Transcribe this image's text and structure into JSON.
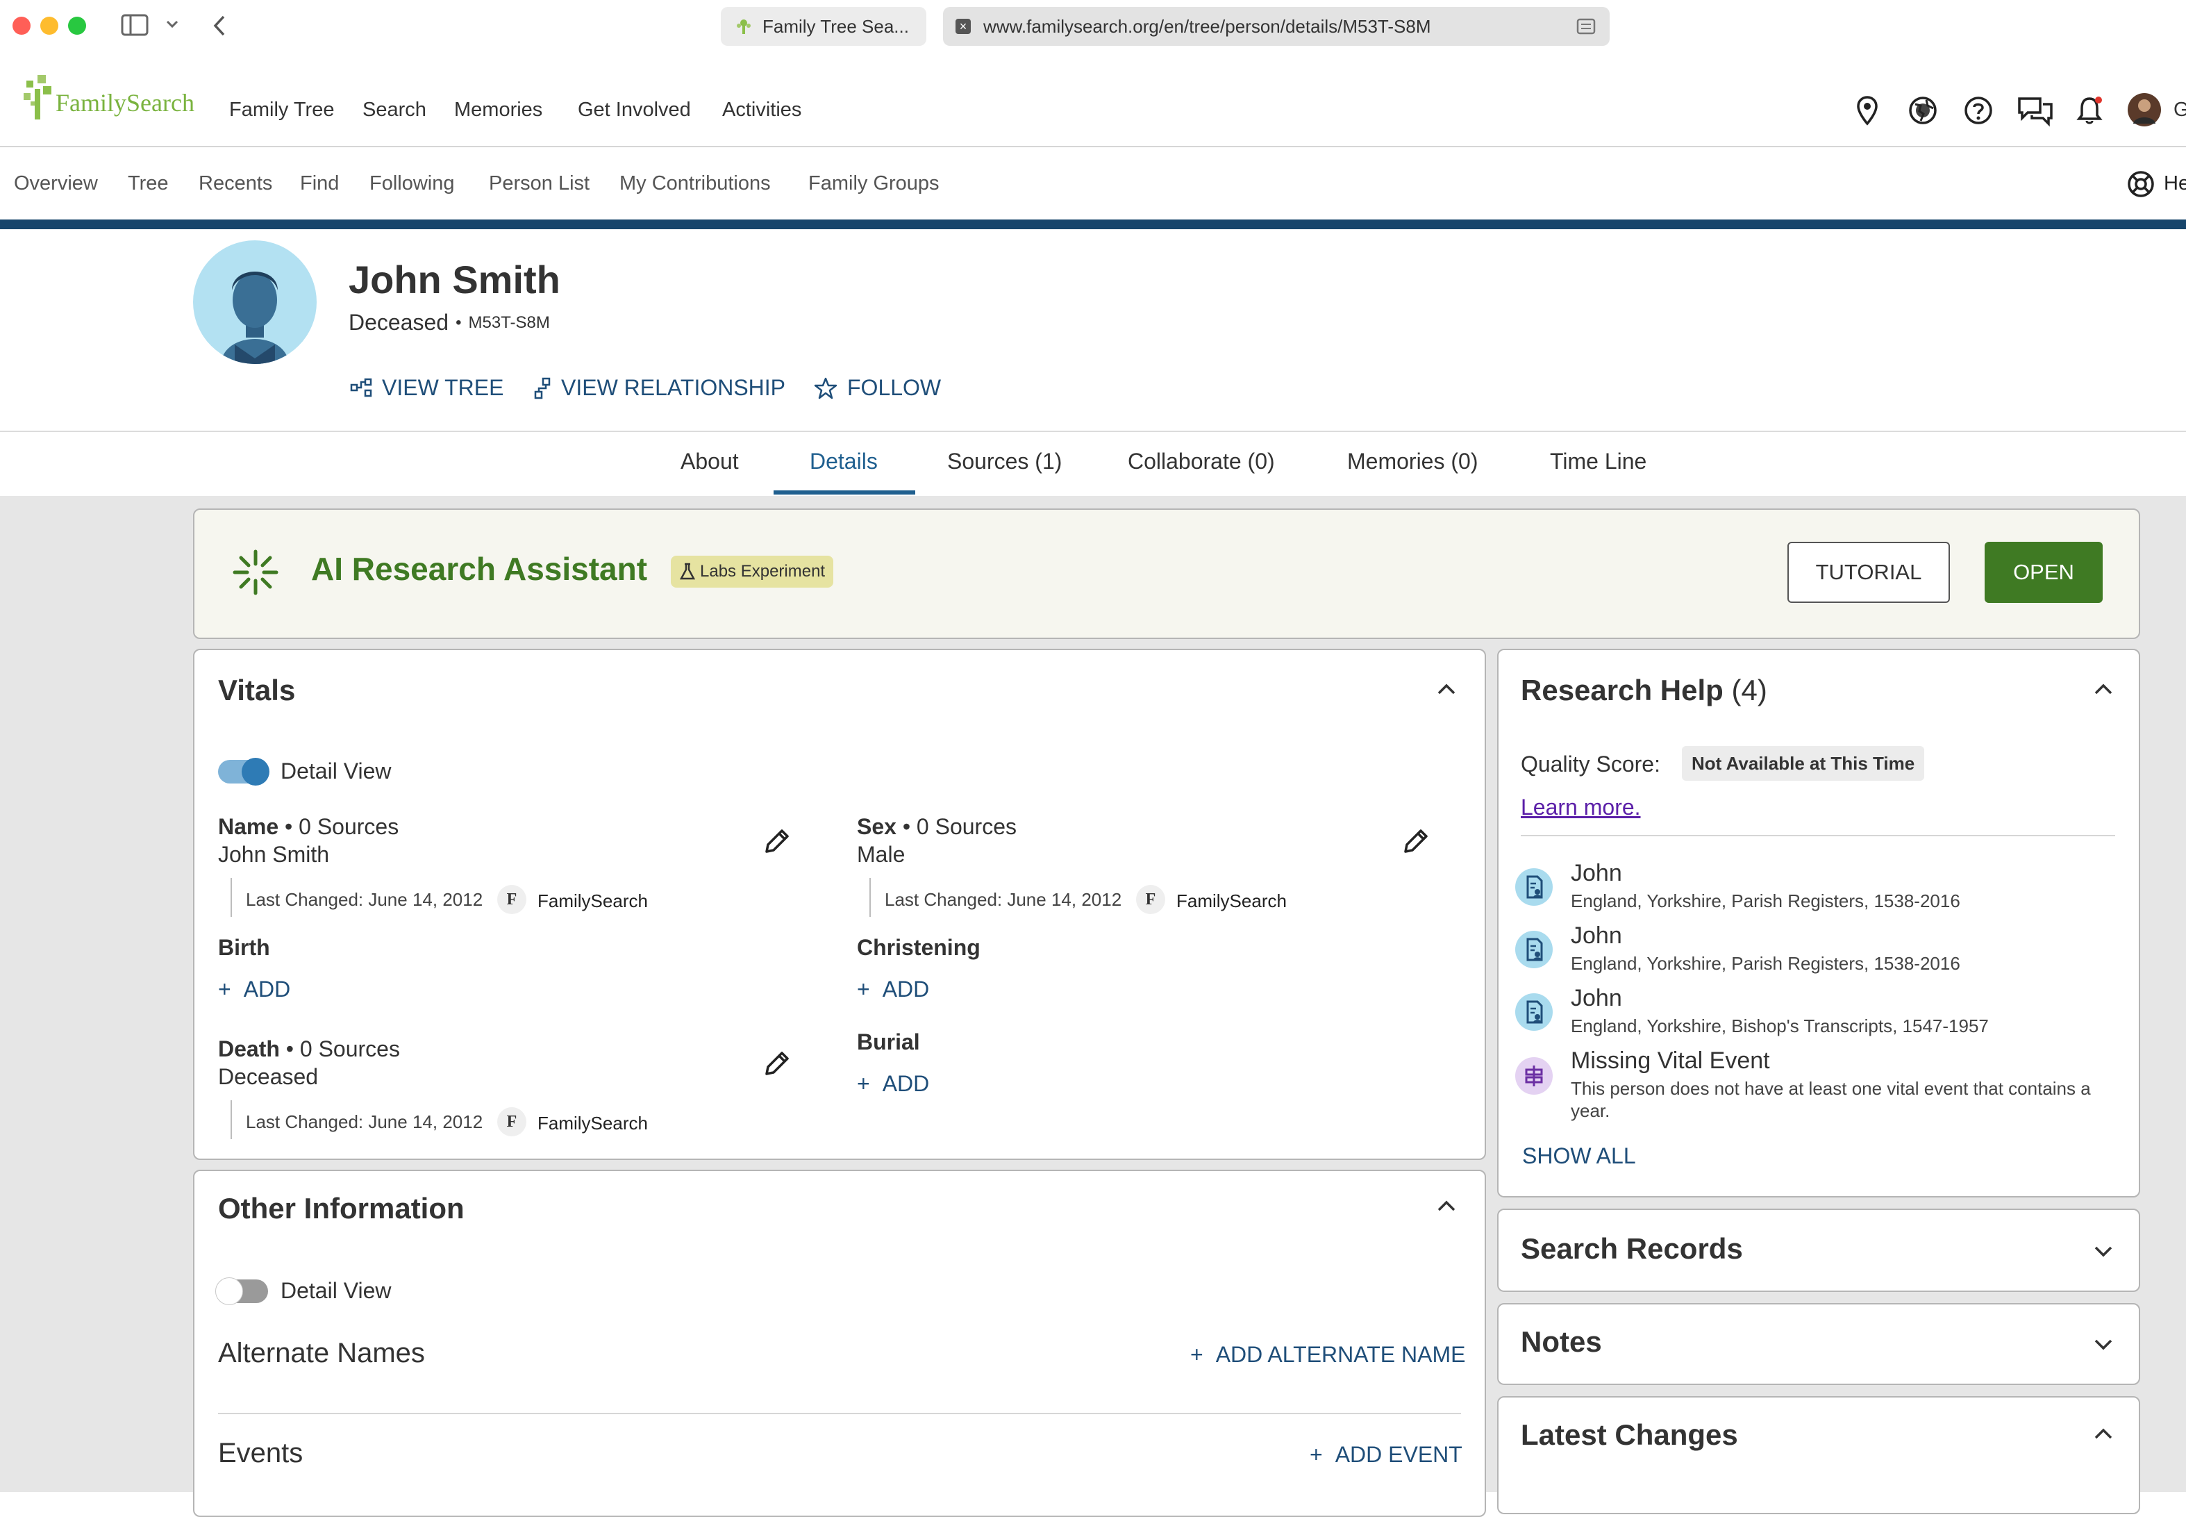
{
  "browser": {
    "tab_title": "Family Tree Sea...",
    "url": "www.familysearch.org/en/tree/person/details/M53T-S8M"
  },
  "header": {
    "logo_text": "FamilySearch",
    "nav": [
      "Family Tree",
      "Search",
      "Memories",
      "Get Involved",
      "Activities"
    ],
    "user_initial_partial": "G"
  },
  "subnav": {
    "items": [
      "Overview",
      "Tree",
      "Recents",
      "Find",
      "Following",
      "Person List",
      "My Contributions",
      "Family Groups"
    ],
    "help_partial": "He"
  },
  "person": {
    "name": "John Smith",
    "status": "Deceased",
    "separator": "•",
    "pid": "M53T-S8M",
    "actions": [
      "VIEW TREE",
      "VIEW RELATIONSHIP",
      "FOLLOW"
    ]
  },
  "tabs": {
    "items": [
      "About",
      "Details",
      "Sources (1)",
      "Collaborate (0)",
      "Memories (0)",
      "Time Line"
    ],
    "active": "Details"
  },
  "ai_banner": {
    "title": "AI Research Assistant",
    "badge": "Labs Experiment",
    "tutorial_label": "TUTORIAL",
    "open_label": "OPEN"
  },
  "vitals": {
    "title": "Vitals",
    "detail_view_label": "Detail View",
    "name": {
      "label": "Name",
      "sources": "• 0 Sources",
      "value": "John Smith",
      "last_changed": "Last Changed: June 14, 2012",
      "contributor": "FamilySearch"
    },
    "sex": {
      "label": "Sex",
      "sources": "• 0 Sources",
      "value": "Male",
      "last_changed": "Last Changed: June 14, 2012",
      "contributor": "FamilySearch"
    },
    "birth": {
      "label": "Birth",
      "add": "ADD"
    },
    "christening": {
      "label": "Christening",
      "add": "ADD"
    },
    "death": {
      "label": "Death",
      "sources": "• 0 Sources",
      "value": "Deceased",
      "last_changed": "Last Changed: June 14, 2012",
      "contributor": "FamilySearch"
    },
    "burial": {
      "label": "Burial",
      "add": "ADD"
    },
    "badge_letter": "F"
  },
  "other_info": {
    "title": "Other Information",
    "detail_view_label": "Detail View",
    "alternate_names": "Alternate Names",
    "add_alternate_name": "ADD ALTERNATE NAME",
    "events": "Events",
    "add_event": "ADD EVENT"
  },
  "research_help": {
    "title": "Research Help",
    "count": "(4)",
    "quality_label": "Quality Score:",
    "quality_value": "Not Available at This Time",
    "learn_more": "Learn more.",
    "items": [
      {
        "title": "John",
        "subtitle": "England, Yorkshire, Parish Registers, 1538-2016",
        "icon": "record-hint-icon"
      },
      {
        "title": "John",
        "subtitle": "England, Yorkshire, Parish Registers, 1538-2016",
        "icon": "record-hint-icon"
      },
      {
        "title": "John",
        "subtitle": "England, Yorkshire, Bishop's Transcripts, 1547-1957",
        "icon": "record-hint-icon"
      },
      {
        "title": "Missing Vital Event",
        "subtitle": "This person does not have at least one vital event that contains a",
        "subtitle2": "year.",
        "icon": "data-problem-icon"
      }
    ],
    "show_all": "SHOW ALL"
  },
  "side_cards": {
    "search_records": "Search Records",
    "notes": "Notes",
    "latest_changes": "Latest Changes"
  },
  "colors": {
    "brand_blue": "#17456b",
    "link_blue": "#1f4e79",
    "open_green": "#3f7a23",
    "ai_green": "#3f7a23",
    "banner_bg": "#f6f6ef",
    "badge_bg": "#e6e3a1",
    "record_icon_bg": "#a9dbee",
    "problem_icon_bg": "#e4d2f2",
    "toggle_on": "#2e7bb5"
  }
}
